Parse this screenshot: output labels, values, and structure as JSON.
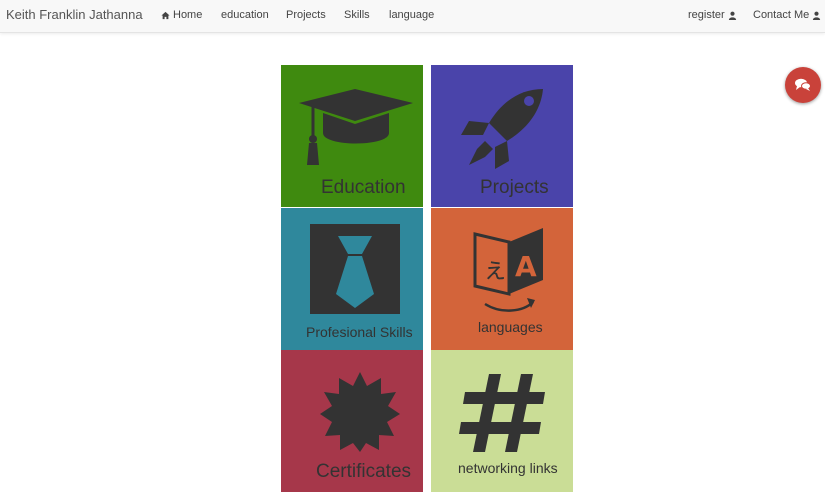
{
  "navbar": {
    "brand": "Keith Franklin Jathanna",
    "links": [
      {
        "label": "Home",
        "icon": "home-icon"
      },
      {
        "label": "education"
      },
      {
        "label": "Projects"
      },
      {
        "label": "Skills"
      },
      {
        "label": "language"
      }
    ],
    "right": [
      {
        "label": "register",
        "icon": "user-icon"
      },
      {
        "label": "Contact Me",
        "icon": "user-icon"
      }
    ]
  },
  "tiles": [
    {
      "label": "Education",
      "icon": "graduation-cap-icon",
      "color": "#3f8a0f"
    },
    {
      "label": "Projects",
      "icon": "rocket-icon",
      "color": "#4a44aa"
    },
    {
      "label": "Profesional Skills",
      "icon": "tie-icon",
      "color": "#2f889c"
    },
    {
      "label": "languages",
      "icon": "translate-icon",
      "color": "#d3643a"
    },
    {
      "label": "Certificates",
      "icon": "certificate-icon",
      "color": "#a6374a"
    },
    {
      "label": "networking links",
      "icon": "hashtag-icon",
      "color": "#cadd96"
    }
  ],
  "chat": {
    "icon": "chat-icon",
    "color": "#c9423a"
  }
}
